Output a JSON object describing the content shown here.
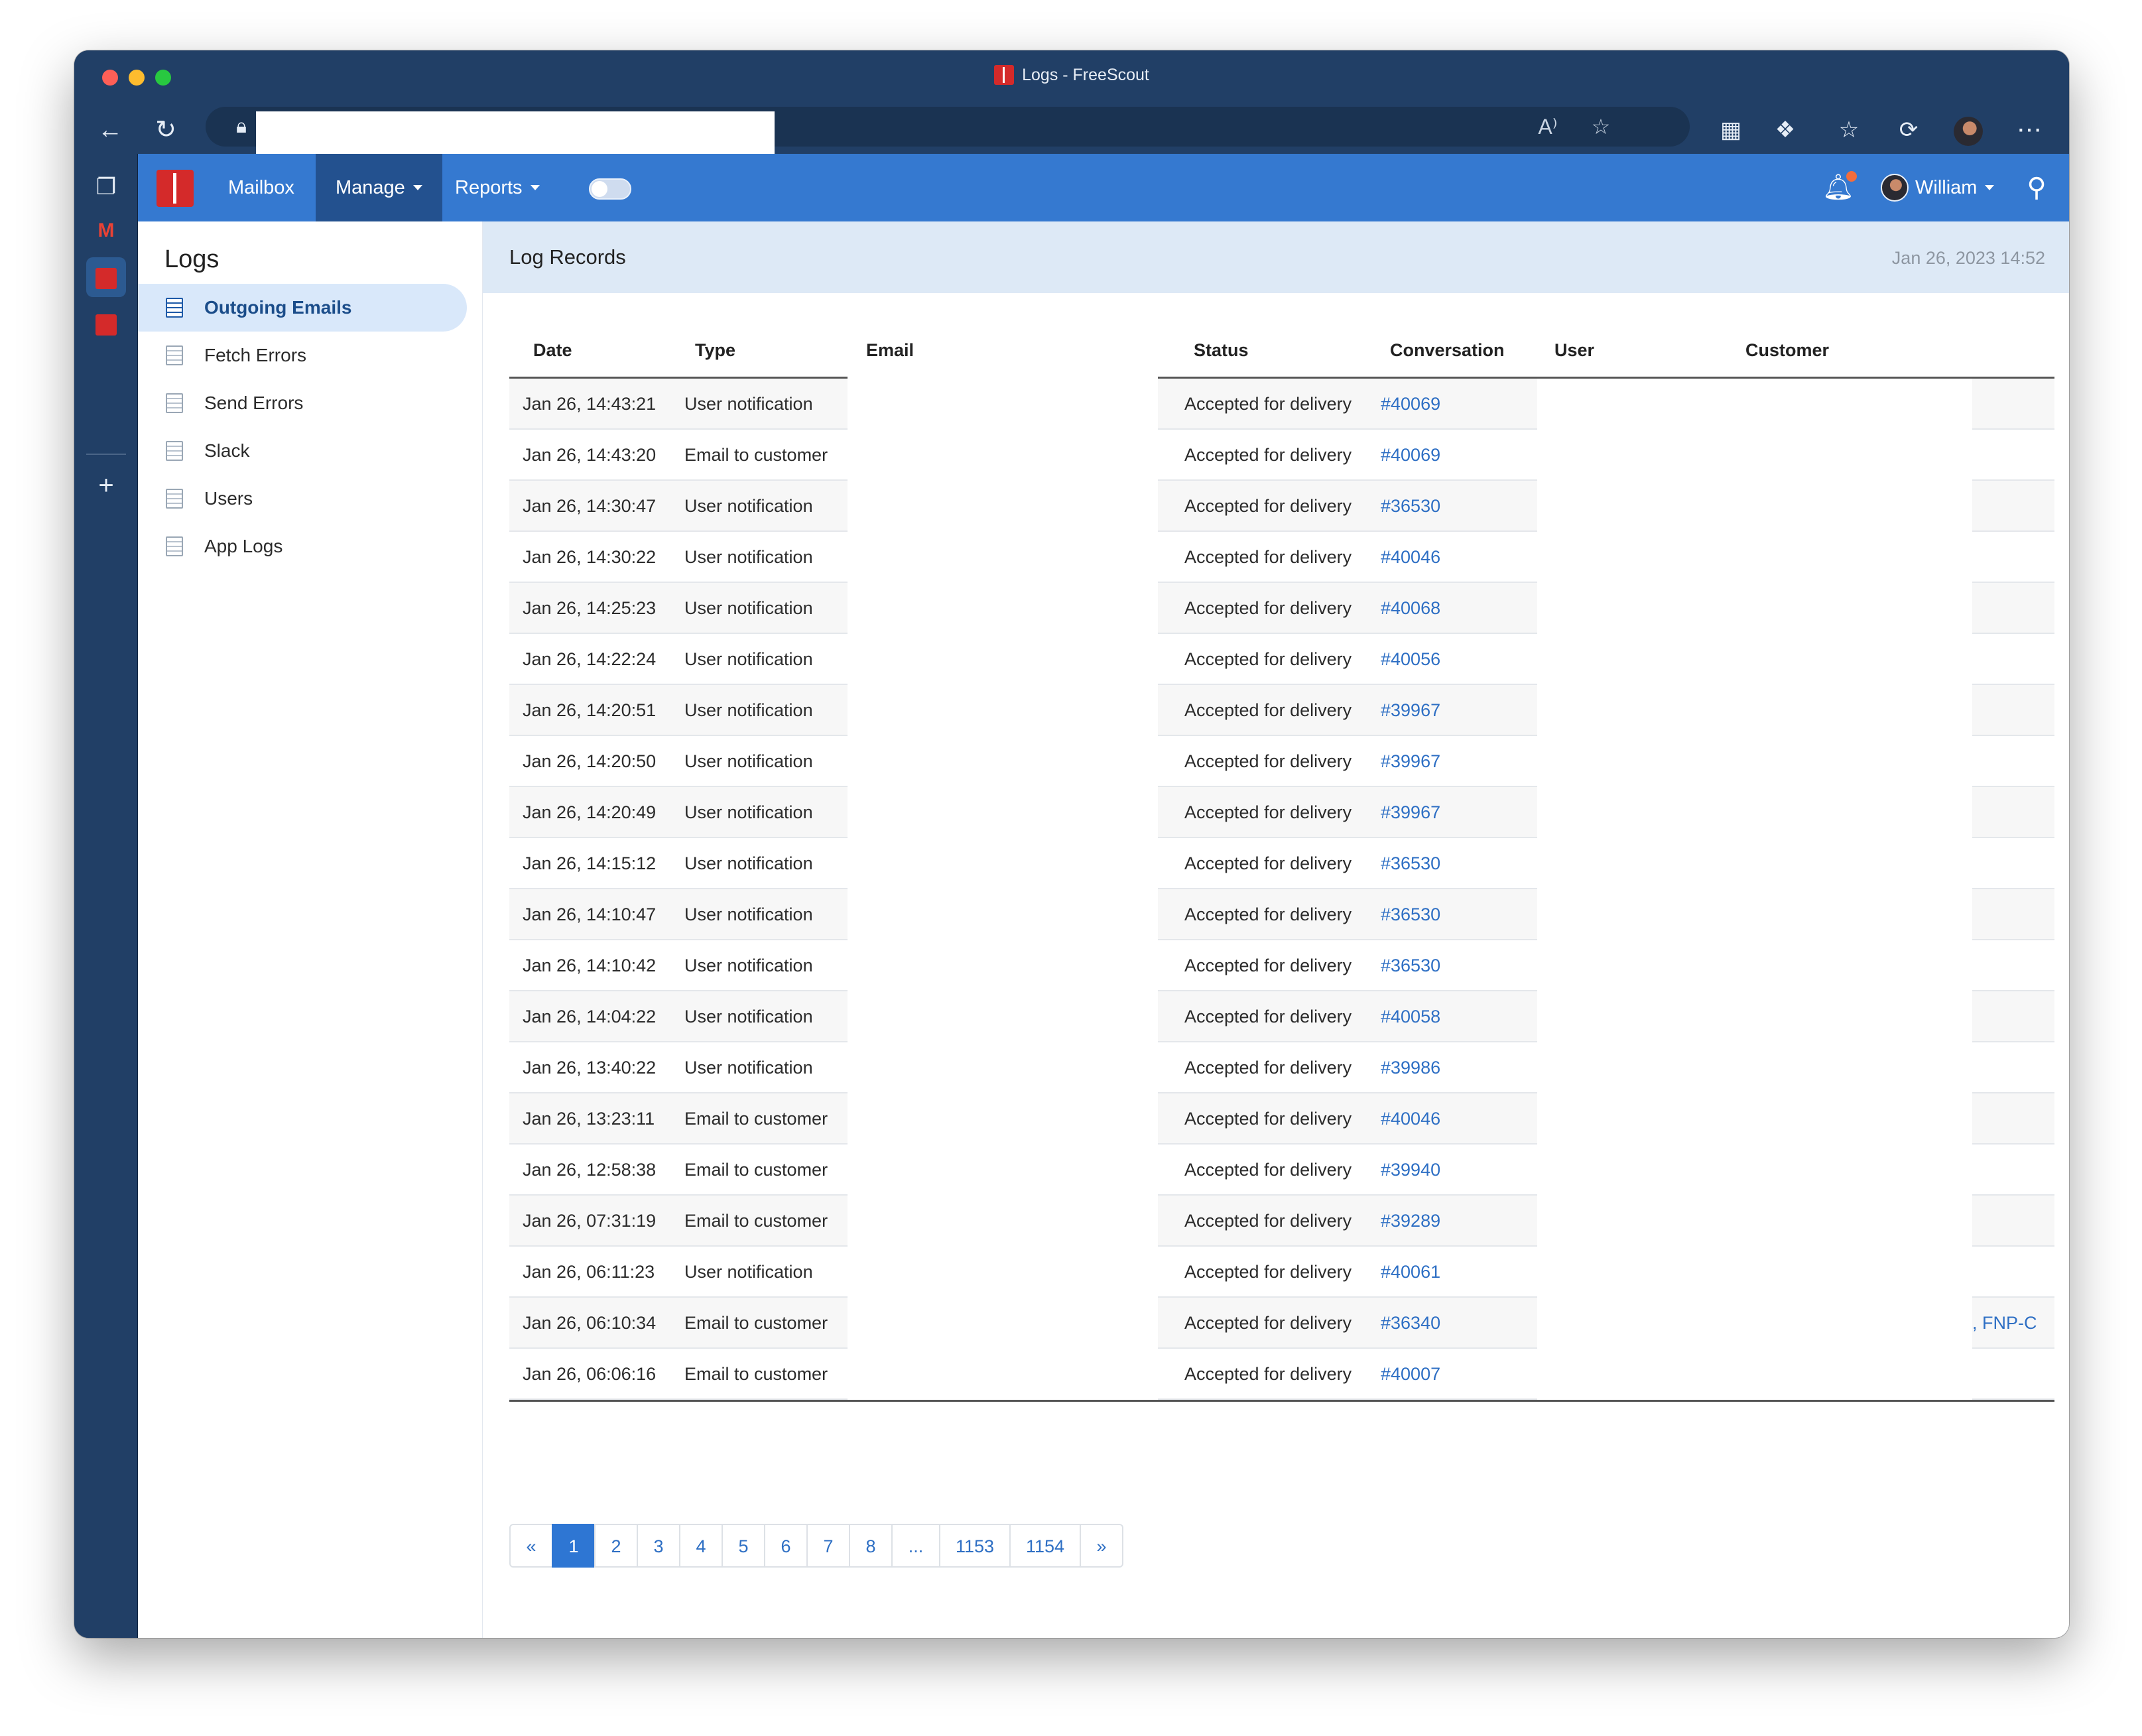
{
  "window": {
    "title": "Logs - FreeScout"
  },
  "navbar": {
    "mailbox": "Mailbox",
    "manage": "Manage",
    "reports": "Reports",
    "user": "William"
  },
  "sidebar": {
    "title": "Logs",
    "items": [
      {
        "label": "Outgoing Emails",
        "active": true
      },
      {
        "label": "Fetch Errors"
      },
      {
        "label": "Send Errors"
      },
      {
        "label": "Slack"
      },
      {
        "label": "Users"
      },
      {
        "label": "App Logs"
      }
    ]
  },
  "content": {
    "title": "Log Records",
    "timestamp": "Jan 26, 2023 14:52"
  },
  "table": {
    "headers": {
      "date": "Date",
      "type": "Type",
      "email": "Email",
      "status": "Status",
      "conversation": "Conversation",
      "user": "User",
      "customer": "Customer"
    },
    "rows": [
      {
        "date": "Jan 26, 14:43:21",
        "type": "User notification",
        "status": "Accepted for delivery",
        "conversation": "#40069",
        "customer": ""
      },
      {
        "date": "Jan 26, 14:43:20",
        "type": "Email to customer",
        "status": "Accepted for delivery",
        "conversation": "#40069",
        "customer": ""
      },
      {
        "date": "Jan 26, 14:30:47",
        "type": "User notification",
        "status": "Accepted for delivery",
        "conversation": "#36530",
        "customer": ""
      },
      {
        "date": "Jan 26, 14:30:22",
        "type": "User notification",
        "status": "Accepted for delivery",
        "conversation": "#40046",
        "customer": ""
      },
      {
        "date": "Jan 26, 14:25:23",
        "type": "User notification",
        "status": "Accepted for delivery",
        "conversation": "#40068",
        "customer": ""
      },
      {
        "date": "Jan 26, 14:22:24",
        "type": "User notification",
        "status": "Accepted for delivery",
        "conversation": "#40056",
        "customer": ""
      },
      {
        "date": "Jan 26, 14:20:51",
        "type": "User notification",
        "status": "Accepted for delivery",
        "conversation": "#39967",
        "customer": ""
      },
      {
        "date": "Jan 26, 14:20:50",
        "type": "User notification",
        "status": "Accepted for delivery",
        "conversation": "#39967",
        "customer": ""
      },
      {
        "date": "Jan 26, 14:20:49",
        "type": "User notification",
        "status": "Accepted for delivery",
        "conversation": "#39967",
        "customer": ""
      },
      {
        "date": "Jan 26, 14:15:12",
        "type": "User notification",
        "status": "Accepted for delivery",
        "conversation": "#36530",
        "customer": ""
      },
      {
        "date": "Jan 26, 14:10:47",
        "type": "User notification",
        "status": "Accepted for delivery",
        "conversation": "#36530",
        "customer": ""
      },
      {
        "date": "Jan 26, 14:10:42",
        "type": "User notification",
        "status": "Accepted for delivery",
        "conversation": "#36530",
        "customer": ""
      },
      {
        "date": "Jan 26, 14:04:22",
        "type": "User notification",
        "status": "Accepted for delivery",
        "conversation": "#40058",
        "customer": ""
      },
      {
        "date": "Jan 26, 13:40:22",
        "type": "User notification",
        "status": "Accepted for delivery",
        "conversation": "#39986",
        "customer": ""
      },
      {
        "date": "Jan 26, 13:23:11",
        "type": "Email to customer",
        "status": "Accepted for delivery",
        "conversation": "#40046",
        "customer": ""
      },
      {
        "date": "Jan 26, 12:58:38",
        "type": "Email to customer",
        "status": "Accepted for delivery",
        "conversation": "#39940",
        "customer": ""
      },
      {
        "date": "Jan 26, 07:31:19",
        "type": "Email to customer",
        "status": "Accepted for delivery",
        "conversation": "#39289",
        "customer": ""
      },
      {
        "date": "Jan 26, 06:11:23",
        "type": "User notification",
        "status": "Accepted for delivery",
        "conversation": "#40061",
        "customer": ""
      },
      {
        "date": "Jan 26, 06:10:34",
        "type": "Email to customer",
        "status": "Accepted for delivery",
        "conversation": "#36340",
        "customer": ", FNP-C"
      },
      {
        "date": "Jan 26, 06:06:16",
        "type": "Email to customer",
        "status": "Accepted for delivery",
        "conversation": "#40007",
        "customer": ""
      }
    ]
  },
  "pagination": [
    "«",
    "1",
    "2",
    "3",
    "4",
    "5",
    "6",
    "7",
    "8",
    "...",
    "1153",
    "1154",
    "»"
  ],
  "pagination_active": "1",
  "colors": {
    "navbar": "#3579d0",
    "navbar_active": "#23518f",
    "link": "#2e6fc4",
    "header_band": "#dde9f6",
    "window_chrome": "#213f66"
  },
  "icons": {
    "toolbar": [
      "back-arrow-icon",
      "reload-icon",
      "lock-icon",
      "read-aloud-icon",
      "favorite-add-icon",
      "qr-code-icon",
      "extensions-icon",
      "favorites-icon",
      "history-icon",
      "profile-avatar",
      "more-icon"
    ],
    "sidebar": [
      "tab-actions-icon",
      "gmail-icon",
      "freescout-icon",
      "freescout-icon",
      "add-icon"
    ]
  }
}
